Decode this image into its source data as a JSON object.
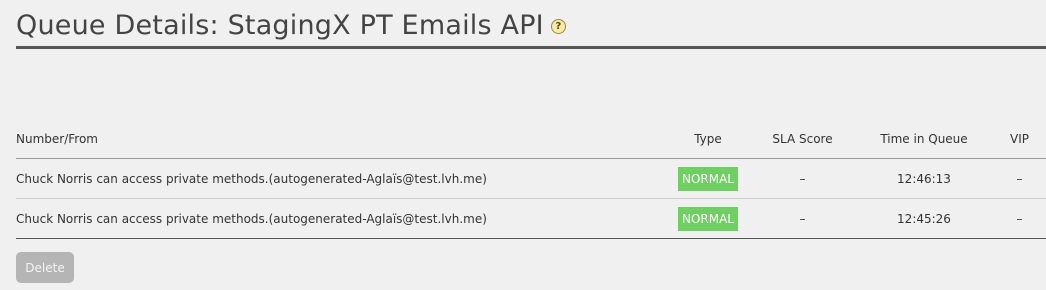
{
  "header": {
    "title": "Queue Details: StagingX PT Emails API",
    "help_icon_glyph": "?"
  },
  "table": {
    "columns": [
      "Number/From",
      "Type",
      "SLA Score",
      "Time in Queue",
      "VIP"
    ],
    "rows": [
      {
        "from": "Chuck Norris can access private methods.(autogenerated-Aglaïs@test.lvh.me)",
        "type": "NORMAL",
        "sla_score": "–",
        "time_in_queue": "12:46:13",
        "vip": "–"
      },
      {
        "from": "Chuck Norris can access private methods.(autogenerated-Aglaïs@test.lvh.me)",
        "type": "NORMAL",
        "sla_score": "–",
        "time_in_queue": "12:45:26",
        "vip": "–"
      }
    ]
  },
  "actions": {
    "delete_label": "Delete"
  },
  "colors": {
    "badge_normal": "#6fcf63",
    "title_rule": "#555555",
    "button_disabled": "#b5b5b5"
  }
}
